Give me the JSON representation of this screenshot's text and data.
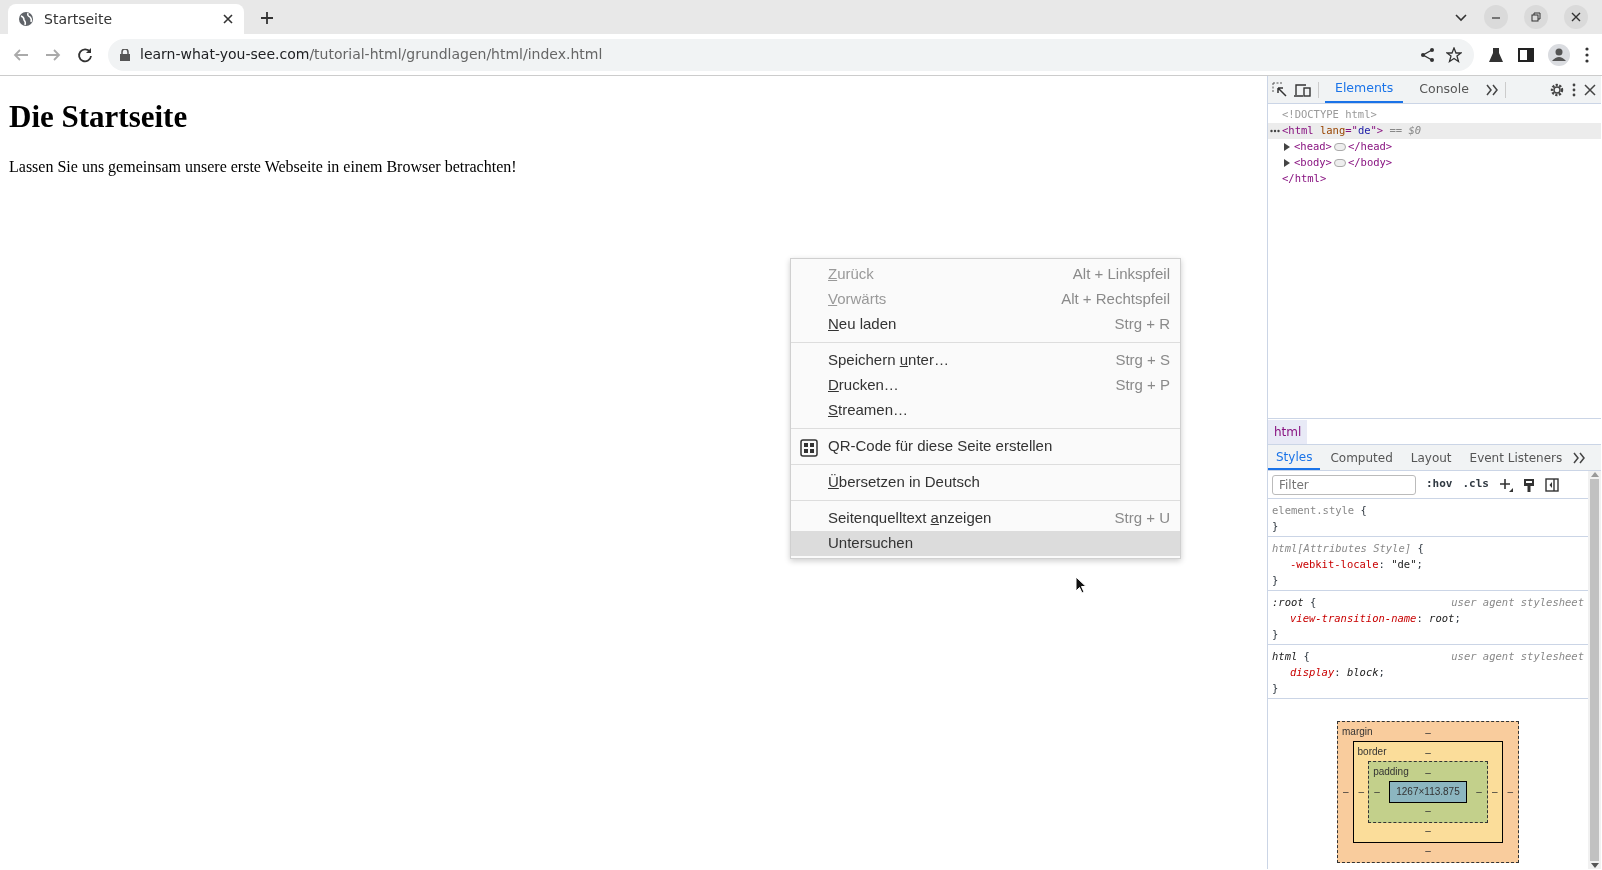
{
  "browser": {
    "tab": {
      "title": "Startseite",
      "selected": true
    },
    "address": {
      "domain": "learn-what-you-see.com",
      "path": "/tutorial-html/grundlagen/html/index.html"
    }
  },
  "page": {
    "heading": "Die Startseite",
    "paragraph": "Lassen Sie uns gemeinsam unsere erste Webseite in einem Browser betrachten!"
  },
  "context_menu": {
    "groups": [
      [
        {
          "access_key": "Z",
          "text_after": "urück",
          "shortcut": "Alt + Linkspfeil",
          "disabled": true,
          "selected": false
        },
        {
          "access_key": "V",
          "text_after": "orwärts",
          "shortcut": "Alt + Rechtspfeil",
          "disabled": true,
          "selected": false
        },
        {
          "access_key": "N",
          "text_after": "eu laden",
          "shortcut": "Strg + R",
          "disabled": false,
          "selected": false
        }
      ],
      [
        {
          "text_before": "Speichern ",
          "access_key": "u",
          "text_after": "nter…",
          "shortcut": "Strg + S",
          "disabled": false,
          "selected": false
        },
        {
          "access_key": "D",
          "text_after": "rucken…",
          "shortcut": "Strg + P",
          "disabled": false,
          "selected": false
        },
        {
          "access_key": "S",
          "text_after": "treamen…",
          "disabled": false,
          "selected": false
        }
      ],
      [
        {
          "kind": "qr",
          "text_after": "QR-Code für diese Seite erstellen",
          "disabled": false,
          "selected": false
        }
      ],
      [
        {
          "access_key": "Ü",
          "text_after": "bersetzen in Deutsch",
          "disabled": false,
          "selected": false
        }
      ],
      [
        {
          "text_before": "Seitenquelltext ",
          "access_key": "a",
          "text_after": "nzeigen",
          "shortcut": "Strg + U",
          "disabled": false,
          "selected": false
        },
        {
          "text_after": "Untersuchen",
          "disabled": false,
          "selected": true
        }
      ]
    ]
  },
  "devtools": {
    "tabs": [
      {
        "label": "Elements",
        "selected": true
      },
      {
        "label": "Console",
        "selected": false
      }
    ],
    "dom": [
      {
        "tokens": [
          {
            "kind": "doctype",
            "text": "<!DOCTYPE html>"
          }
        ],
        "selected": false
      },
      {
        "tokens": [
          {
            "kind": "tag",
            "text": "<html"
          },
          {
            "kind": "attr",
            "text": " lang"
          },
          {
            "kind": "punct",
            "text": "=\""
          },
          {
            "kind": "value",
            "text": "de"
          },
          {
            "kind": "punct",
            "text": "\""
          },
          {
            "kind": "tag",
            "text": ">"
          },
          {
            "kind": "marker",
            "text": " == $0"
          }
        ],
        "selected": true,
        "children": [
          {
            "tokens": [
              {
                "kind": "tag",
                "text": "<head>"
              },
              {
                "kind": "ellipsis"
              },
              {
                "kind": "tag",
                "text": "</head>"
              }
            ],
            "expanded": false,
            "selected": false
          },
          {
            "tokens": [
              {
                "kind": "tag",
                "text": "<body>"
              },
              {
                "kind": "ellipsis"
              },
              {
                "kind": "tag",
                "text": "</body>"
              }
            ],
            "expanded": false,
            "selected": false
          }
        ]
      },
      {
        "tokens": [
          {
            "kind": "tag",
            "text": "</html>"
          }
        ],
        "selected": false
      }
    ],
    "breadcrumb": "html",
    "subtabs": [
      {
        "label": "Styles",
        "selected": true
      },
      {
        "label": "Computed",
        "selected": false
      },
      {
        "label": "Layout",
        "selected": false
      },
      {
        "label": "Event Listeners",
        "selected": false
      }
    ],
    "filter": {
      "placeholder": "Filter"
    },
    "hov": ":hov",
    "cls": ".cls",
    "rules": [
      {
        "kind": "inline",
        "lines": [
          [
            {
              "kind": "selector",
              "text": "element.style"
            },
            {
              "kind": "punct",
              "text": " {"
            }
          ],
          [
            {
              "kind": "punct",
              "text": "}"
            }
          ]
        ]
      },
      {
        "kind": "attributes",
        "lines": [
          [
            {
              "kind": "selector",
              "text": "html[Attributes Style]"
            },
            {
              "kind": "punct",
              "text": " {"
            }
          ],
          [
            {
              "kind": "name",
              "text": "-webkit-locale"
            },
            {
              "kind": "punct",
              "text": ": "
            },
            {
              "kind": "value",
              "text": "\"de\""
            },
            {
              "kind": "punct",
              "text": ";"
            }
          ],
          [
            {
              "kind": "punct",
              "text": "}"
            }
          ]
        ]
      },
      {
        "kind": "ua",
        "origin": "user agent stylesheet",
        "lines": [
          [
            {
              "kind": "selector",
              "text": ":root"
            },
            {
              "kind": "punct",
              "text": " {"
            }
          ],
          [
            {
              "kind": "name",
              "text": "view-transition-name"
            },
            {
              "kind": "punct",
              "text": ": "
            },
            {
              "kind": "value",
              "text": "root"
            },
            {
              "kind": "punct",
              "text": ";"
            }
          ],
          [
            {
              "kind": "punct",
              "text": "}"
            }
          ]
        ]
      },
      {
        "kind": "ua",
        "origin": "user agent stylesheet",
        "lines": [
          [
            {
              "kind": "selector",
              "text": "html"
            },
            {
              "kind": "punct",
              "text": " {"
            }
          ],
          [
            {
              "kind": "name",
              "text": "display"
            },
            {
              "kind": "punct",
              "text": ": "
            },
            {
              "kind": "value",
              "text": "block"
            },
            {
              "kind": "punct",
              "text": ";"
            }
          ],
          [
            {
              "kind": "punct",
              "text": "}"
            }
          ]
        ]
      }
    ],
    "box_model": {
      "margin": {
        "label": "margin",
        "top": "–",
        "right": "–",
        "bottom": "–",
        "left": "–"
      },
      "border": {
        "label": "border",
        "top": "–",
        "right": "–",
        "bottom": "–",
        "left": "–"
      },
      "padding": {
        "label": "padding",
        "top": "–",
        "right": "–",
        "bottom": "–",
        "left": "–"
      },
      "content": "1267×113.875"
    }
  }
}
